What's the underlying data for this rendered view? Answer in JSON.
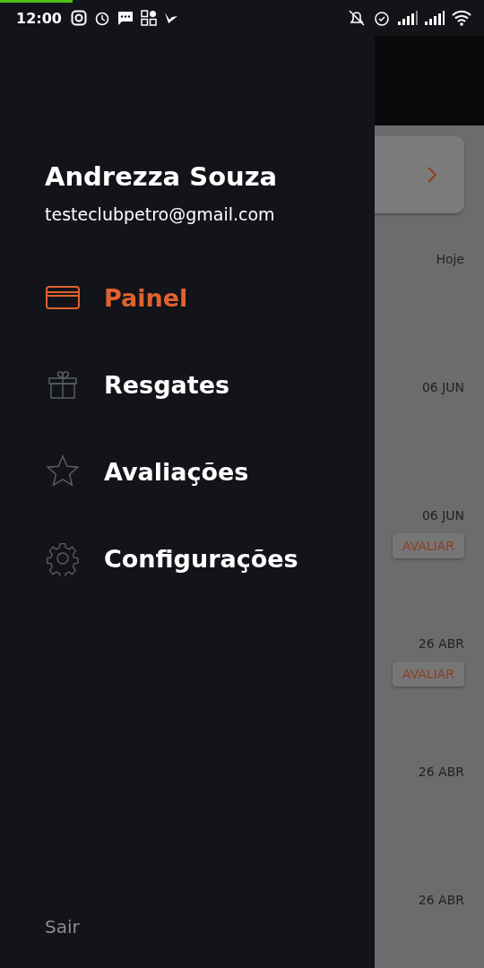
{
  "status_bar": {
    "time": "12:00",
    "loading": {
      "level": 0.15
    }
  },
  "background": {
    "rows": [
      {
        "date": "Hoje"
      },
      {
        "date": "06 JUN"
      },
      {
        "date": "06 JUN",
        "action": "AVALIAR"
      },
      {
        "date": "26 ABR",
        "action": "AVALIAR"
      },
      {
        "date": "26 ABR"
      },
      {
        "date": "26 ABR"
      }
    ]
  },
  "drawer": {
    "user": {
      "name": "Andrezza Souza",
      "email": "testeclubpetro@gmail.com"
    },
    "items": [
      {
        "kind": "card",
        "label": "Painel",
        "selected": true
      },
      {
        "kind": "gift",
        "label": "Resgates",
        "selected": false
      },
      {
        "kind": "star",
        "label": "Avaliações",
        "selected": false
      },
      {
        "kind": "gear",
        "label": "Configurações",
        "selected": false
      }
    ],
    "logout": "Sair"
  }
}
